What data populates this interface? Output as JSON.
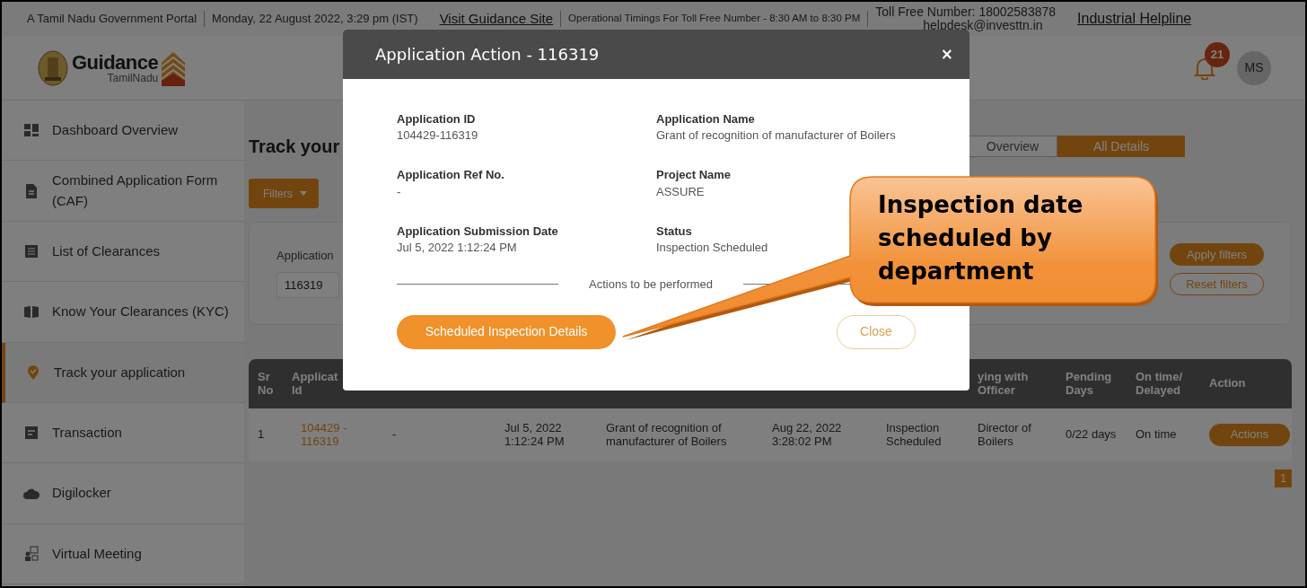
{
  "top_bar": {
    "portal": "A Tamil Nadu Government Portal",
    "datetime": "Monday, 22 August 2022, 3:29 pm (IST)",
    "link": "Visit Guidance Site",
    "timings": "Operational Timings For Toll Free Number - 8:30 AM to 8:30 PM",
    "toll_free": "Toll Free Number: 18002583878",
    "email": "helpdesk@investtn.in",
    "helpline": "Industrial Helpline"
  },
  "header": {
    "logo_title": "Guidance",
    "logo_subtitle": "TamilNadu",
    "notifications": "21",
    "avatar": "MS"
  },
  "sidebar": {
    "items": [
      {
        "label": "Dashboard Overview",
        "selected": false
      },
      {
        "label": "Combined Application Form (CAF)",
        "selected": false
      },
      {
        "label": "List of Clearances",
        "selected": false
      },
      {
        "label": "Know Your Clearances (KYC)",
        "selected": false
      },
      {
        "label": "Track your application",
        "selected": true
      },
      {
        "label": "Transaction",
        "selected": false
      },
      {
        "label": "Digilocker",
        "selected": false
      },
      {
        "label": "Virtual Meeting",
        "selected": false
      }
    ]
  },
  "page": {
    "title": "Track your",
    "view_tabs": [
      {
        "label": "Overview",
        "selected": false
      },
      {
        "label": "All Details",
        "selected": true
      }
    ],
    "filters_button": "Filters",
    "filter": {
      "label": "Application",
      "value": "116319"
    },
    "apply_button": "Apply filters",
    "reset_button": "Reset filters"
  },
  "table": {
    "columns_left": [
      "Sr No",
      "Applicat Id"
    ],
    "columns_right": [
      "ying with Officer",
      "Pending Days",
      "On time/ Delayed",
      "Action"
    ],
    "rows": [
      {
        "cells": [
          "1",
          "104429 - 116319",
          "-",
          "Jul 5, 2022 1:12:24 PM",
          "Grant of recognition of manufacturer of Boilers",
          "Aug 22, 2022 3:28:02 PM",
          "Inspection Scheduled",
          "Director of Boilers",
          "0/22 days",
          "On time"
        ],
        "action": "Actions"
      }
    ]
  },
  "pagination": [
    {
      "label": "1",
      "selected": true
    }
  ],
  "modal": {
    "title": "Application Action - 116319",
    "close_icon": "×",
    "fields": [
      {
        "label": "Application ID",
        "value": "104429-116319"
      },
      {
        "label": "Application Name",
        "value": "Grant of recognition of manufacturer of Boilers"
      },
      {
        "label": "Application Ref No.",
        "value": "-"
      },
      {
        "label": "Project Name",
        "value": "ASSURE"
      },
      {
        "label": "Application Submission Date",
        "value": "Jul 5, 2022 1:12:24 PM"
      },
      {
        "label": "Status",
        "value": "Inspection Scheduled"
      }
    ],
    "divider_text": "Actions to be performed",
    "primary_button": "Scheduled Inspection Details",
    "close_button": "Close"
  },
  "callout": {
    "text": "Inspection date scheduled by department"
  }
}
